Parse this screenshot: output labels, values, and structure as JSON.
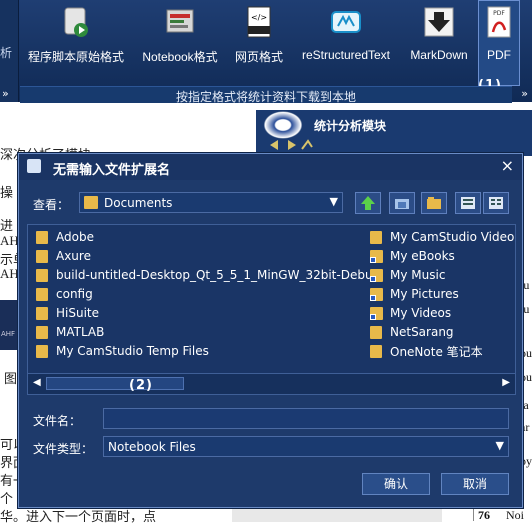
{
  "ribbon": {
    "left_partial_label": "析",
    "buttons": [
      {
        "label": "程序脚本原始格式",
        "icon": "script-icon"
      },
      {
        "label": "Notebook格式",
        "icon": "notebook-icon"
      },
      {
        "label": "网页格式",
        "icon": "html-icon"
      },
      {
        "label": "reStructuredText",
        "icon": "rst-icon"
      },
      {
        "label": "MarkDown",
        "icon": "download-arrow-icon"
      },
      {
        "label": "PDF",
        "icon": "pdf-icon"
      }
    ],
    "footer_text": "按指定格式将统计资料下载到本地",
    "annotation_1": "(1)"
  },
  "panel": {
    "title": "统计分析模块"
  },
  "background": {
    "lines": [
      "深次分析了模块",
      "操",
      "进",
      "AH",
      "示单",
      "AH",
      "AHF",
      "图",
      "可以",
      "界面",
      "有一",
      "个",
      "华。进入下一个页面时，点"
    ],
    "right_fragments": [
      "lu",
      "lu",
      "ou",
      "ou",
      "ta",
      "ar",
      "py",
      "Noi",
      "76"
    ]
  },
  "dialog": {
    "title": "无需输入文件扩展名",
    "look_in_label": "查看：",
    "look_in_value": "Documents",
    "files_left": [
      "Adobe",
      "Axure",
      "build-untitled-Desktop_Qt_5_5_1_MinGW_32bit-Debug",
      "config",
      "HiSuite",
      "MATLAB",
      "My CamStudio Temp Files"
    ],
    "files_right": [
      "My CamStudio Video",
      "My eBooks",
      "My Music",
      "My Pictures",
      "My Videos",
      "NetSarang",
      "OneNote 笔记本"
    ],
    "annotation_2": "(2)",
    "filename_label": "文件名：",
    "filename_value": "",
    "filetype_label": "文件类型：",
    "filetype_value": "Notebook Files",
    "ok_label": "确认",
    "cancel_label": "取消"
  },
  "colors": {
    "ribbon_bg": "#1f3e73",
    "dialog_bg": "#1e3a6b",
    "folder": "#e8b94a",
    "text": "#ffffff"
  }
}
